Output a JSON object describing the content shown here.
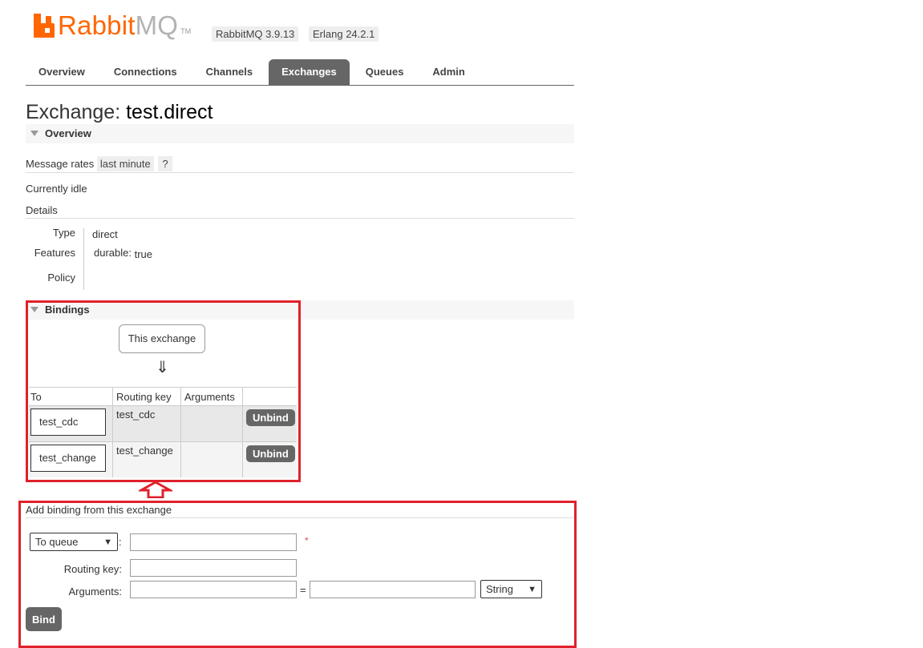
{
  "header": {
    "logo_brand": "Rabbit",
    "logo_suffix": "MQ",
    "logo_tm": "TM",
    "rabbitmq_version": "RabbitMQ 3.9.13",
    "erlang_version": "Erlang 24.2.1"
  },
  "tabs": [
    "Overview",
    "Connections",
    "Channels",
    "Exchanges",
    "Queues",
    "Admin"
  ],
  "active_tab": "Exchanges",
  "page": {
    "title_prefix": "Exchange:",
    "title_name": "test.direct"
  },
  "overview": {
    "section_label": "Overview",
    "message_rates_label": "Message rates",
    "rate_period": "last minute",
    "help": "?",
    "status": "Currently idle",
    "details_label": "Details",
    "type_label": "Type",
    "type_value": "direct",
    "features_label": "Features",
    "feature_key": "durable:",
    "feature_value": "true",
    "policy_label": "Policy"
  },
  "bindings": {
    "section_label": "Bindings",
    "this_exchange": "This exchange",
    "arrow": "⇓",
    "columns": [
      "To",
      "Routing key",
      "Arguments",
      ""
    ],
    "rows": [
      {
        "to": "test_cdc",
        "routing_key": "test_cdc",
        "arguments": "",
        "action": "Unbind"
      },
      {
        "to": "test_change",
        "routing_key": "test_change",
        "arguments": "",
        "action": "Unbind"
      }
    ]
  },
  "add_binding": {
    "title": "Add binding from this exchange",
    "destination_type": "To queue",
    "required_mark": "*",
    "routing_key_label": "Routing key:",
    "arguments_label": "Arguments:",
    "equals": "=",
    "arg_type": "String",
    "bind_button": "Bind"
  },
  "colors": {
    "brand_orange": "#ff6600",
    "highlight_red": "#e0212b",
    "button_grey": "#666666"
  }
}
